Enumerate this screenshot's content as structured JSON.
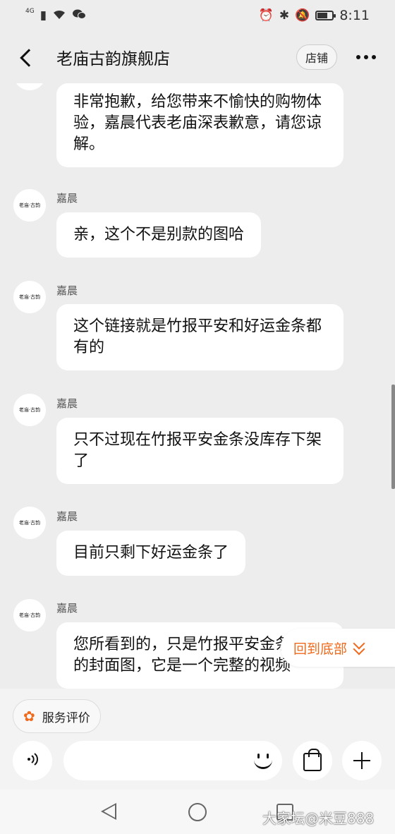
{
  "status_bar": {
    "network": "4G",
    "time": "8:11",
    "battery_level": 0.7
  },
  "header": {
    "title": "老庙古韵旗舰店",
    "shop_button": "店铺"
  },
  "avatar_text": "老庙·古韵",
  "messages": [
    {
      "sender": "",
      "text": "非常抱歉，给您带来不愉快的购物体验，嘉晨代表老庙深表歉意，请您谅解。"
    },
    {
      "sender": "嘉晨",
      "text": "亲，这个不是别款的图哈"
    },
    {
      "sender": "嘉晨",
      "text": "这个链接就是竹报平安和好运金条都有的"
    },
    {
      "sender": "嘉晨",
      "text": "只不过现在竹报平安金条没库存下架了"
    },
    {
      "sender": "嘉晨",
      "text": "目前只剩下好运金条了"
    },
    {
      "sender": "嘉晨",
      "text": "您所看到的，只是竹报平安金条视频的封面图，它是一个完整的视频"
    }
  ],
  "jump_to_bottom": "回到底部",
  "service_rating": "服务评价",
  "input": {
    "placeholder": ""
  },
  "watermark": "大家坛@米豆888"
}
